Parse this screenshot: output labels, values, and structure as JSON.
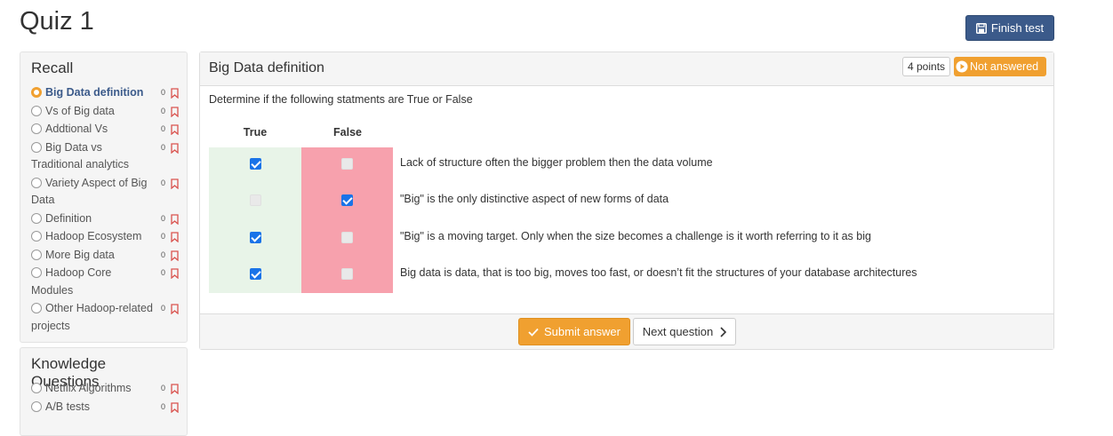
{
  "page": {
    "title": "Quiz 1",
    "finish_label": "Finish test"
  },
  "colors": {
    "primary": "#3b5a8a",
    "warning": "#f0a030",
    "true_bg": "#e8f4e8",
    "false_bg": "#f7a1ad",
    "checkbox": "#1a73e8",
    "flag": "#d9534f"
  },
  "sidebar": {
    "sections": [
      {
        "heading": "Recall",
        "items": [
          {
            "label": "Big Data definition",
            "count": "0",
            "active": true
          },
          {
            "label": "Vs of Big data",
            "count": "0",
            "active": false
          },
          {
            "label": "Addtional Vs",
            "count": "0",
            "active": false
          },
          {
            "label": "Big Data vs Traditional analytics",
            "count": "0",
            "active": false
          },
          {
            "label": "Variety Aspect of Big Data",
            "count": "0",
            "active": false
          },
          {
            "label": "Definition",
            "count": "0",
            "active": false
          },
          {
            "label": "Hadoop Ecosystem",
            "count": "0",
            "active": false
          },
          {
            "label": "More Big data",
            "count": "0",
            "active": false
          },
          {
            "label": "Hadoop Core Modules",
            "count": "0",
            "active": false
          },
          {
            "label": "Other Hadoop-related projects",
            "count": "0",
            "active": false
          }
        ]
      },
      {
        "heading": "Knowledge Questions",
        "items": [
          {
            "label": "Netflix Algorithms",
            "count": "0",
            "active": false
          },
          {
            "label": "A/B tests",
            "count": "0",
            "active": false
          }
        ]
      }
    ]
  },
  "question": {
    "title": "Big Data definition",
    "points": "4 points",
    "status": "Not answered",
    "instructions": "Determine if the following statments are True or False",
    "true_header": "True",
    "false_header": "False",
    "statements": [
      {
        "text": "Lack of structure often the bigger problem then the data volume",
        "true_state": "checked",
        "false_state": "disabled"
      },
      {
        "text": "\"Big\" is the only distinctive aspect of new forms of data",
        "true_state": "disabled",
        "false_state": "checked"
      },
      {
        "text": "\"Big\" is a moving target. Only when the size becomes a challenge is it worth referring to it as big",
        "true_state": "checked",
        "false_state": "disabled"
      },
      {
        "text": "Big data is data, that is too big, moves too fast, or doesn’t fit the structures of your database architectures",
        "true_state": "checked",
        "false_state": "disabled"
      }
    ],
    "submit_label": "Submit answer",
    "next_label": "Next question"
  }
}
